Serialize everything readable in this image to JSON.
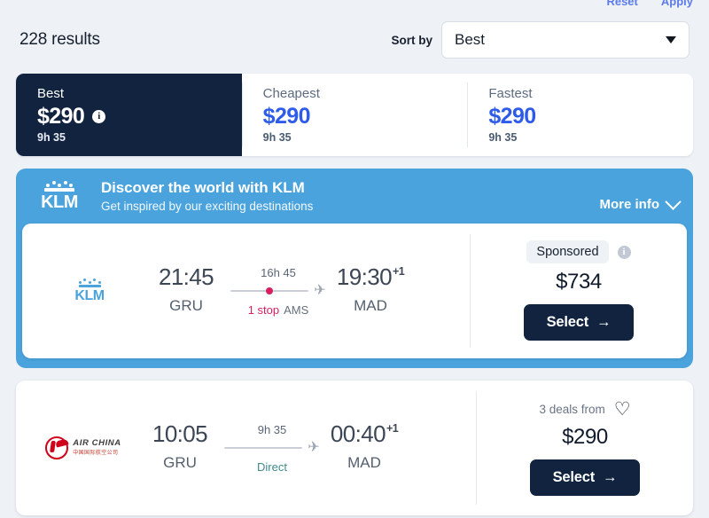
{
  "top_links": [
    "Reset",
    "Apply"
  ],
  "header": {
    "results_count": "228 results",
    "sort_label": "Sort by",
    "sort_value": "Best",
    "sort_options": [
      "Best",
      "Cheapest",
      "Fastest"
    ]
  },
  "tabs": [
    {
      "name": "Best",
      "price": "$290",
      "duration": "9h 35",
      "has_info": true,
      "active": true
    },
    {
      "name": "Cheapest",
      "price": "$290",
      "duration": "9h 35",
      "has_info": false,
      "active": false
    },
    {
      "name": "Fastest",
      "price": "$290",
      "duration": "9h 35",
      "has_info": false,
      "active": false
    }
  ],
  "promo": {
    "airline": "KLM",
    "title": "Discover the world with KLM",
    "subtitle": "Get inspired by our exciting destinations",
    "more_info": "More info",
    "background": "#4aa3dc"
  },
  "flights": [
    {
      "airline": "KLM",
      "depart_time": "21:45",
      "depart_code": "GRU",
      "duration": "16h 45",
      "stops_count": "1 stop",
      "stops_via": "AMS",
      "direct": false,
      "arrive_time": "19:30",
      "arrive_offset": "+1",
      "arrive_code": "MAD",
      "badge": "Sponsored",
      "badge_has_info": true,
      "price": "$734",
      "select_label": "Select",
      "favorite": false
    },
    {
      "airline": "Air China",
      "airline_en": "AIR CHINA",
      "airline_cn": "中国国际航空公司",
      "depart_time": "10:05",
      "depart_code": "GRU",
      "duration": "9h 35",
      "stops_label": "Direct",
      "direct": true,
      "arrive_time": "00:40",
      "arrive_offset": "+1",
      "arrive_code": "MAD",
      "deals_label": "3 deals from",
      "price": "$290",
      "select_label": "Select",
      "favorite": true
    }
  ],
  "colors": {
    "page_bg": "#eef1f6",
    "dark_navy": "#11233f",
    "accent_blue": "#2f5bea",
    "klm_blue": "#4aa3dc",
    "stop_pink": "#d81f5e",
    "direct_teal": "#3f8a8d",
    "airchina_red": "#d0021b"
  },
  "icons": {
    "caret": "▼",
    "plane": "✈",
    "heart": "♡",
    "arrow": "→",
    "info": "i"
  }
}
